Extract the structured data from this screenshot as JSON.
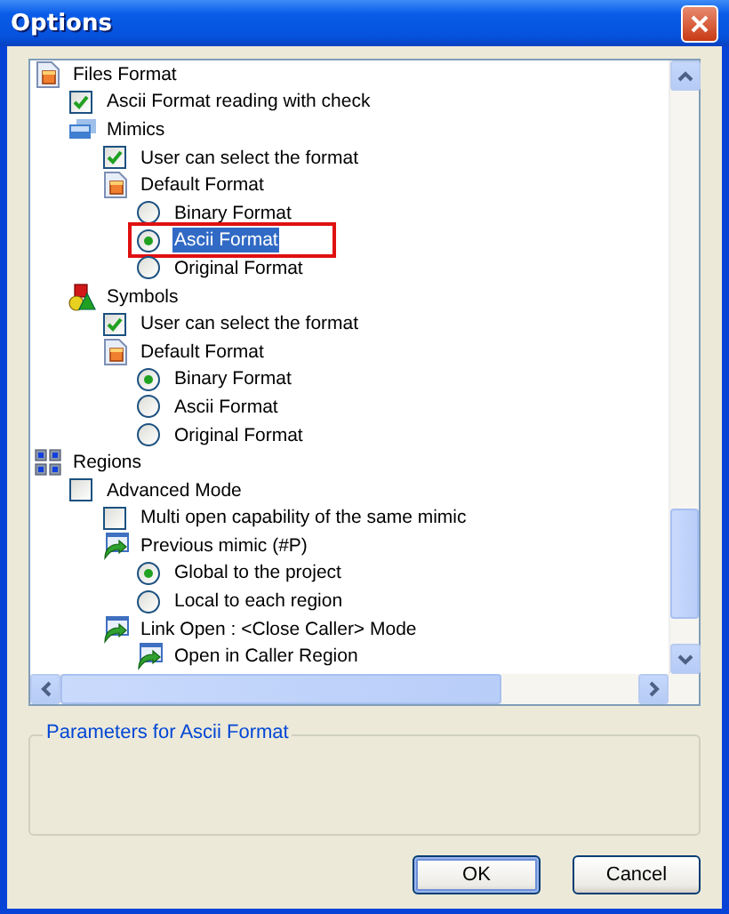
{
  "window": {
    "title": "Options"
  },
  "tree": {
    "items": [
      {
        "kind": "document",
        "label": "Files Format",
        "selected": false,
        "outlined": false,
        "children": [
          {
            "kind": "checkbox",
            "label": "Ascii Format reading with check",
            "checked": true,
            "selected": false,
            "outlined": false
          },
          {
            "kind": "screens",
            "label": "Mimics",
            "selected": false,
            "outlined": false,
            "children": [
              {
                "kind": "checkbox",
                "label": "User can select the format",
                "checked": true,
                "selected": false,
                "outlined": false
              },
              {
                "kind": "document",
                "label": "Default Format",
                "selected": false,
                "outlined": false,
                "children": [
                  {
                    "kind": "radio",
                    "label": "Binary Format",
                    "checked": false,
                    "selected": false,
                    "outlined": false
                  },
                  {
                    "kind": "radio",
                    "label": "Ascii Format",
                    "checked": true,
                    "selected": true,
                    "outlined": true
                  },
                  {
                    "kind": "radio",
                    "label": "Original Format",
                    "checked": false,
                    "selected": false,
                    "outlined": false
                  }
                ]
              }
            ]
          },
          {
            "kind": "shapes",
            "label": "Symbols",
            "selected": false,
            "outlined": false,
            "children": [
              {
                "kind": "checkbox",
                "label": "User can select the format",
                "checked": true,
                "selected": false,
                "outlined": false
              },
              {
                "kind": "document",
                "label": "Default Format",
                "selected": false,
                "outlined": false,
                "children": [
                  {
                    "kind": "radio",
                    "label": "Binary Format",
                    "checked": true,
                    "selected": false,
                    "outlined": false
                  },
                  {
                    "kind": "radio",
                    "label": "Ascii Format",
                    "checked": false,
                    "selected": false,
                    "outlined": false
                  },
                  {
                    "kind": "radio",
                    "label": "Original Format",
                    "checked": false,
                    "selected": false,
                    "outlined": false
                  }
                ]
              }
            ]
          }
        ]
      },
      {
        "kind": "grid",
        "label": "Regions",
        "selected": false,
        "outlined": false,
        "children": [
          {
            "kind": "checkbox",
            "label": "Advanced Mode",
            "checked": false,
            "selected": false,
            "outlined": false,
            "children": [
              {
                "kind": "checkbox",
                "label": "Multi open capability of the same mimic",
                "checked": false,
                "selected": false,
                "outlined": false
              },
              {
                "kind": "arrow",
                "label": "Previous mimic (#P)",
                "selected": false,
                "outlined": false,
                "children": [
                  {
                    "kind": "radio",
                    "label": "Global to the project",
                    "checked": true,
                    "selected": false,
                    "outlined": false
                  },
                  {
                    "kind": "radio",
                    "label": "Local to each region",
                    "checked": false,
                    "selected": false,
                    "outlined": false
                  }
                ]
              },
              {
                "kind": "arrow",
                "label": "Link Open : <Close Caller> Mode",
                "selected": false,
                "outlined": false,
                "children": [
                  {
                    "kind": "arrow",
                    "label": "Open in Caller Region",
                    "selected": false,
                    "outlined": false
                  }
                ]
              }
            ]
          }
        ]
      }
    ]
  },
  "parameters": {
    "title": "Parameters for Ascii Format"
  },
  "buttons": [
    {
      "label": "OK",
      "default": true
    },
    {
      "label": "Cancel",
      "default": false
    }
  ]
}
